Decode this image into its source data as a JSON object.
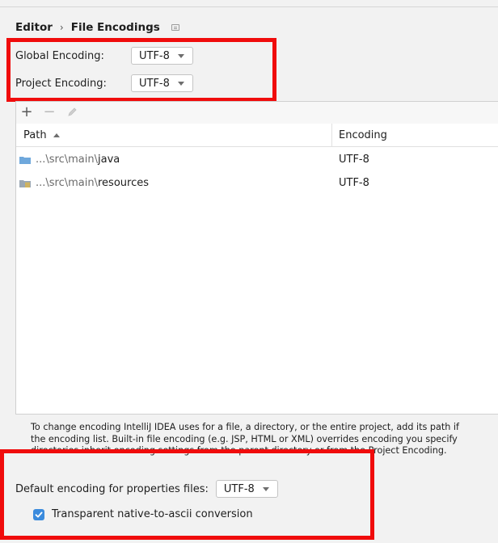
{
  "breadcrumb": {
    "parent": "Editor",
    "separator": "›",
    "current": "File Encodings"
  },
  "global_encoding": {
    "label": "Global Encoding:",
    "value": "UTF-8"
  },
  "project_encoding": {
    "label": "Project Encoding:",
    "value": "UTF-8"
  },
  "toolbar": {
    "add": "+",
    "remove": "−"
  },
  "table": {
    "columns": {
      "path": "Path",
      "encoding": "Encoding"
    },
    "rows": [
      {
        "path_prefix": "...\\src\\main\\",
        "path_name": "java",
        "encoding": "UTF-8",
        "icon": "folder-icon"
      },
      {
        "path_prefix": "...\\src\\main\\",
        "path_name": "resources",
        "encoding": "UTF-8",
        "icon": "resources-folder-icon"
      }
    ]
  },
  "help_text": {
    "line1": "To change encoding IntelliJ IDEA uses for a file, a directory, or the entire project, add its path if",
    "line2": "the encoding list. Built-in file encoding (e.g. JSP, HTML or XML) overrides encoding you specify",
    "line3": "directories inherit encoding settings from the parent directory or from the Project Encoding."
  },
  "properties_encoding": {
    "label": "Default encoding for properties files:",
    "value": "UTF-8"
  },
  "native_to_ascii": {
    "label": "Transparent native-to-ascii conversion",
    "checked": true
  },
  "colors": {
    "highlight_box": "#f00c0c",
    "checkbox": "#3b8bdd",
    "folder": "#6fa8dc"
  }
}
